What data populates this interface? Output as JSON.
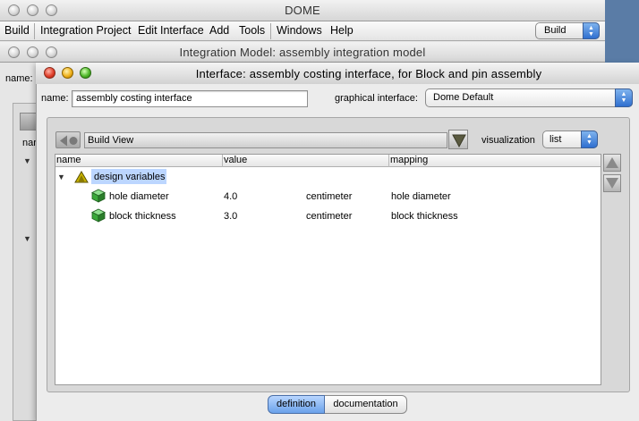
{
  "dome_window": {
    "title": "DOME",
    "menu": [
      "Build",
      "Integration Project",
      "Edit Interface",
      "Add",
      "Tools",
      "Windows",
      "Help"
    ],
    "mode_select": "Build"
  },
  "integration_model_window": {
    "title": "Integration Model: assembly integration model",
    "name_label": "name:",
    "column_header_partial": "nar"
  },
  "interface_window": {
    "title": "Interface: assembly costing interface, for Block and pin assembly",
    "name_label": "name:",
    "name_value": "assembly costing interface",
    "graphical_interface_label": "graphical interface:",
    "graphical_interface_value": "Dome Default",
    "view_value": "Build View",
    "visualization_label": "visualization",
    "visualization_value": "list",
    "table": {
      "headers": [
        "name",
        "value",
        "mapping"
      ],
      "group": {
        "name": "design variables",
        "icon": "folder-icon",
        "expanded": true
      },
      "rows": [
        {
          "name": "hole diameter",
          "value": "4.0",
          "unit": "centimeter",
          "mapping": "hole diameter",
          "icon": "cube-icon"
        },
        {
          "name": "block thickness",
          "value": "3.0",
          "unit": "centimeter",
          "mapping": "block thickness",
          "icon": "cube-icon"
        }
      ]
    },
    "tabs": [
      {
        "label": "definition",
        "active": true
      },
      {
        "label": "documentation",
        "active": false
      }
    ]
  },
  "colors": {
    "selection": "#bcd6ff",
    "active_tab": "#6aa1ea",
    "cube": "#3aa83a",
    "desktop": "#5f7fa3"
  }
}
